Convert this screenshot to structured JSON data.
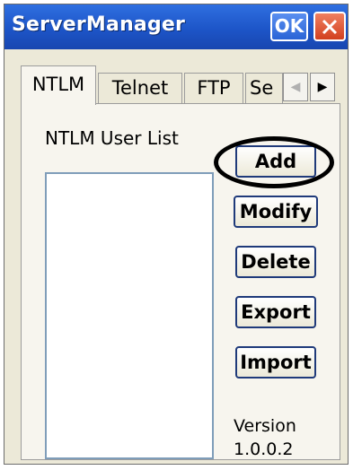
{
  "window": {
    "title": "ServerManager",
    "ok_label": "OK"
  },
  "tabs": [
    {
      "label": "NTLM",
      "active": true
    },
    {
      "label": "Telnet",
      "active": false
    },
    {
      "label": "FTP",
      "active": false
    },
    {
      "label": "Se",
      "active": false
    }
  ],
  "tab_scroll": {
    "left_icon": "arrow-left-icon",
    "right_icon": "arrow-right-icon"
  },
  "ntlm": {
    "list_label": "NTLM User List",
    "users": [],
    "buttons": {
      "add": "Add",
      "modify": "Modify",
      "delete": "Delete",
      "export": "Export",
      "import": "Import"
    },
    "version_label": "Version",
    "version_number": "1.0.0.2"
  },
  "annotation": {
    "highlighted_button": "Add",
    "color": "#000000"
  },
  "colors": {
    "titlebar": "#1d55c8",
    "close_button": "#d2401f",
    "window_bg": "#ece9d8"
  }
}
